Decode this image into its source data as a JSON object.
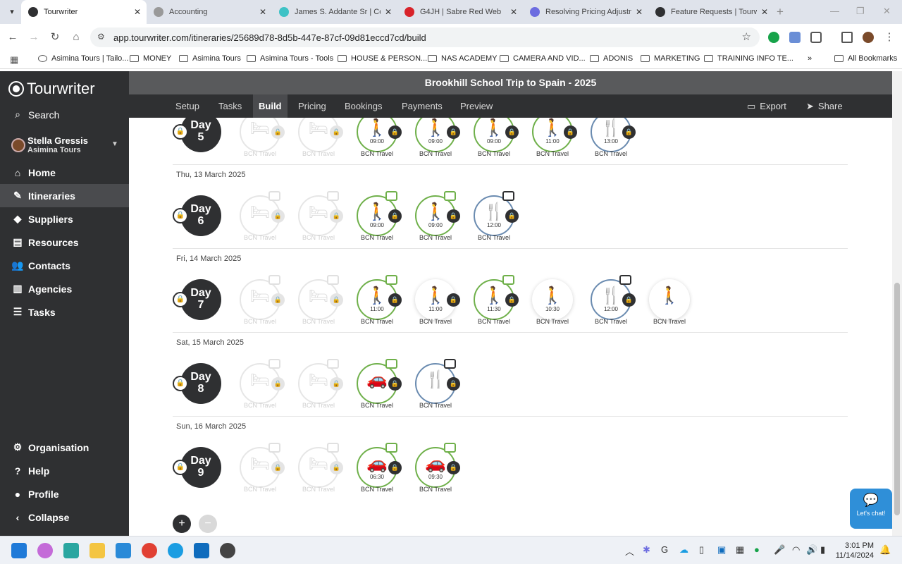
{
  "browser": {
    "tabs": [
      {
        "title": "Tourwriter",
        "active": true
      },
      {
        "title": "Accounting"
      },
      {
        "title": "James S. Addante Sr | Cont"
      },
      {
        "title": "G4JH | Sabre Red Web"
      },
      {
        "title": "Resolving Pricing Adjustme"
      },
      {
        "title": "Feature Requests | Tourwri"
      }
    ],
    "url": "app.tourwriter.com/itineraries/25689d78-8d5b-447e-87cf-09d81eccd7cd/build",
    "bookmarks": [
      "Asimina Tours | Tailo...",
      "MONEY",
      "Asimina Tours",
      "Asimina Tours - Tools",
      "HOUSE & PERSON...",
      "NAS ACADEMY",
      "CAMERA AND VID...",
      "ADONIS",
      "MARKETING",
      "TRAINING INFO TE..."
    ],
    "all_bookmarks": "All Bookmarks"
  },
  "app": {
    "logo": "Tourwriter",
    "search": "Search",
    "user": {
      "name": "Stella Gressis",
      "org": "Asimina Tours"
    },
    "nav": [
      "Home",
      "Itineraries",
      "Suppliers",
      "Resources",
      "Contacts",
      "Agencies",
      "Tasks"
    ],
    "nav_bottom": [
      "Organisation",
      "Help",
      "Profile",
      "Collapse"
    ],
    "trip_title": "Brookhill School Trip to Spain - 2025",
    "tabs": [
      "Setup",
      "Tasks",
      "Build",
      "Pricing",
      "Bookings",
      "Payments",
      "Preview"
    ],
    "export": "Export",
    "share": "Share",
    "chat": "Let's chat!"
  },
  "days": [
    {
      "date": "",
      "day_label": "Day",
      "day_num": "5",
      "services": [
        {
          "type": "bed",
          "state": "ghost",
          "time": "",
          "label": "BCN Travel"
        },
        {
          "type": "bed",
          "state": "ghost",
          "time": "",
          "label": "BCN Travel"
        },
        {
          "type": "walk",
          "state": "green",
          "time": "09:00",
          "label": "BCN Travel"
        },
        {
          "type": "walk",
          "state": "green",
          "time": "09:00",
          "label": "BCN Travel"
        },
        {
          "type": "walk",
          "state": "green",
          "time": "09:00",
          "label": "BCN Travel"
        },
        {
          "type": "walk",
          "state": "green",
          "time": "11:00",
          "label": "BCN Travel"
        },
        {
          "type": "food",
          "state": "blue",
          "time": "13:00",
          "label": "BCN Travel"
        }
      ]
    },
    {
      "date": "Thu, 13 March 2025",
      "day_label": "Day",
      "day_num": "6",
      "services": [
        {
          "type": "bed",
          "state": "ghost",
          "time": "",
          "label": "BCN Travel"
        },
        {
          "type": "bed",
          "state": "ghost",
          "time": "",
          "label": "BCN Travel"
        },
        {
          "type": "walk",
          "state": "green",
          "time": "09:00",
          "label": "BCN Travel"
        },
        {
          "type": "walk",
          "state": "green",
          "time": "09:00",
          "label": "BCN Travel"
        },
        {
          "type": "food",
          "state": "blue",
          "time": "12:00",
          "label": "BCN Travel"
        }
      ]
    },
    {
      "date": "Fri, 14 March 2025",
      "day_label": "Day",
      "day_num": "7",
      "services": [
        {
          "type": "bed",
          "state": "ghost",
          "time": "",
          "label": "BCN Travel"
        },
        {
          "type": "bed",
          "state": "ghost",
          "time": "",
          "label": "BCN Travel"
        },
        {
          "type": "walk",
          "state": "green",
          "time": "11:00",
          "label": "BCN Travel"
        },
        {
          "type": "walk",
          "state": "none",
          "time": "11:00",
          "label": "BCN Travel"
        },
        {
          "type": "walk",
          "state": "green",
          "time": "11:30",
          "label": "BCN Travel"
        },
        {
          "type": "walk",
          "state": "none",
          "time": "10:30",
          "label": "BCN Travel"
        },
        {
          "type": "food",
          "state": "blue",
          "time": "12:00",
          "label": "BCN Travel"
        },
        {
          "type": "walk",
          "state": "none",
          "time": "",
          "label": "BCN Travel"
        }
      ]
    },
    {
      "date": "Sat, 15 March 2025",
      "day_label": "Day",
      "day_num": "8",
      "services": [
        {
          "type": "bed",
          "state": "ghost",
          "time": "",
          "label": "BCN Travel"
        },
        {
          "type": "bed",
          "state": "ghost",
          "time": "",
          "label": "BCN Travel"
        },
        {
          "type": "car",
          "state": "green",
          "time": "",
          "label": "BCN Travel"
        },
        {
          "type": "food",
          "state": "blue",
          "time": "",
          "label": "BCN Travel"
        }
      ]
    },
    {
      "date": "Sun, 16 March 2025",
      "day_label": "Day",
      "day_num": "9",
      "services": [
        {
          "type": "bed",
          "state": "ghost",
          "time": "",
          "label": "BCN Travel"
        },
        {
          "type": "bed",
          "state": "ghost",
          "time": "",
          "label": "BCN Travel"
        },
        {
          "type": "car",
          "state": "green",
          "time": "06:30",
          "label": "BCN Travel"
        },
        {
          "type": "car",
          "state": "green",
          "time": "09:30",
          "label": "BCN Travel"
        }
      ]
    }
  ],
  "taskbar": {
    "time": "3:01 PM",
    "date": "11/14/2024"
  },
  "colors": {
    "green": "#6fb04a",
    "blue": "#6a8bb0",
    "dark": "#2f3032",
    "accent": "#2f8fd8"
  }
}
